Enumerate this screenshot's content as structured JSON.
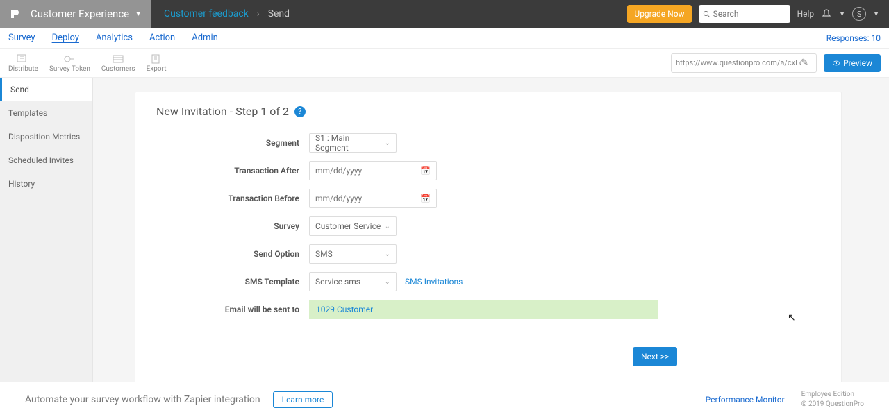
{
  "topbar": {
    "app_name": "Customer Experience",
    "breadcrumb_parent": "Customer feedback",
    "breadcrumb_current": "Send",
    "upgrade_label": "Upgrade Now",
    "search_placeholder": "Search",
    "help_label": "Help",
    "avatar_initial": "S"
  },
  "mainnav": {
    "items": [
      "Survey",
      "Deploy",
      "Analytics",
      "Action",
      "Admin"
    ],
    "active_index": 1,
    "responses_label": "Responses: 10"
  },
  "toolbar": {
    "tools": [
      {
        "label": "Distribute",
        "icon": "distribute-icon"
      },
      {
        "label": "Survey Token",
        "icon": "token-icon"
      },
      {
        "label": "Customers",
        "icon": "customers-icon"
      },
      {
        "label": "Export",
        "icon": "export-icon"
      }
    ],
    "url_value": "https://www.questionpro.com/a/cxLogin",
    "preview_label": "Preview"
  },
  "sidebar": {
    "items": [
      {
        "label": "Send"
      },
      {
        "label": "Templates"
      },
      {
        "label": "Disposition Metrics"
      },
      {
        "label": "Scheduled Invites"
      },
      {
        "label": "History"
      }
    ],
    "active_index": 0
  },
  "card": {
    "title": "New Invitation - Step 1 of 2",
    "labels": {
      "segment": "Segment",
      "trans_after": "Transaction After",
      "trans_before": "Transaction Before",
      "survey": "Survey",
      "send_option": "Send Option",
      "sms_template": "SMS Template",
      "recipients_label": "Email will be sent to"
    },
    "values": {
      "segment": "S1 : Main Segment",
      "trans_after_placeholder": "mm/dd/yyyy",
      "trans_before_placeholder": "mm/dd/yyyy",
      "survey": "Customer Service",
      "send_option": "SMS",
      "sms_template": "Service sms",
      "sms_invitations_link": "SMS Invitations",
      "recipients": "1029 Customer"
    },
    "next_label": "Next >>"
  },
  "footer": {
    "promo": "Automate your survey workflow with Zapier integration",
    "learn_label": "Learn more",
    "perf_label": "Performance Monitor",
    "edition_line1": "Employee Edition",
    "edition_line2": "© 2019 QuestionPro"
  }
}
